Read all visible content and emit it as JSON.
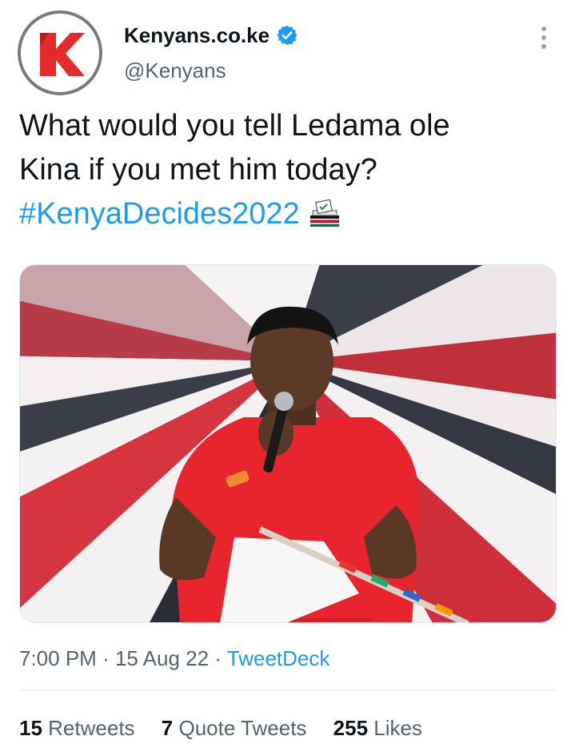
{
  "author": {
    "name": "Kenyans.co.ke",
    "handle": "@Kenyans",
    "avatar_icon": "kenyans-k-logo-icon",
    "verified_icon": "verified-badge-icon"
  },
  "tweet": {
    "text_line1": "What would you tell Ledama ole",
    "text_line2": "Kina if you met him today?",
    "hashtag": "#KenyaDecides2022",
    "emoji_icon": "ballot-box-kenya-flag-icon"
  },
  "media": {
    "icon": "photo-man-speaking-microphone"
  },
  "meta": {
    "time": "7:00 PM",
    "separator": "·",
    "date": "15 Aug 22",
    "source": "TweetDeck"
  },
  "stats": {
    "retweets_count": "15",
    "retweets_label": "Retweets",
    "quotes_count": "7",
    "quotes_label": "Quote Tweets",
    "likes_count": "255",
    "likes_label": "Likes"
  },
  "colors": {
    "link": "#1d9bf0",
    "secondary_text": "#536471",
    "primary_text": "#0f1419",
    "brand_red": "#e32b2b"
  }
}
